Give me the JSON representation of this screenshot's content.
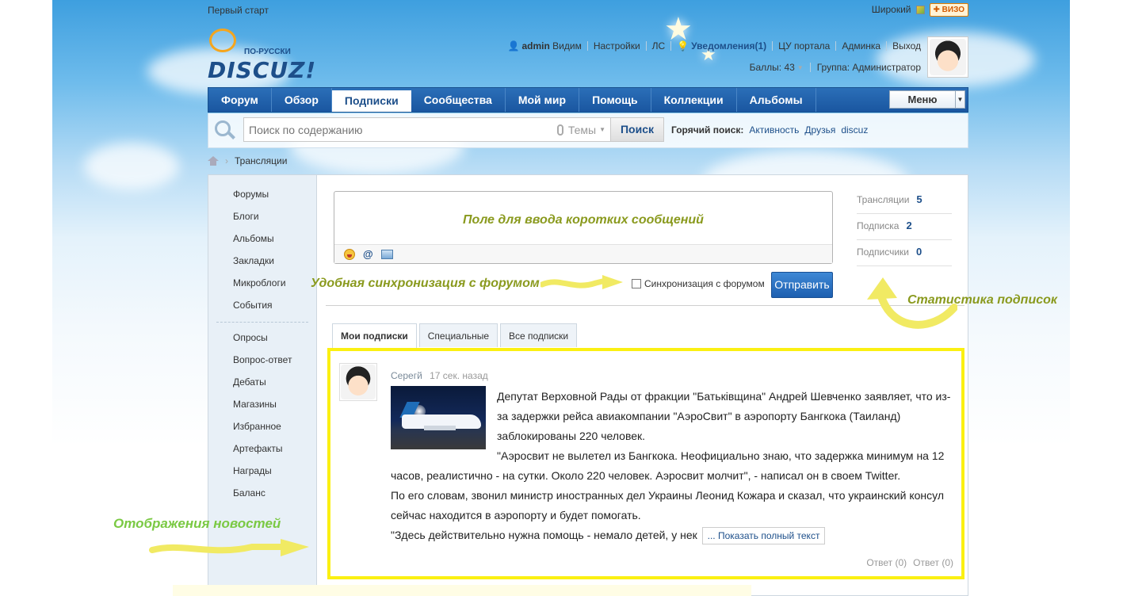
{
  "topbar": {
    "first_start": "Первый старт",
    "wide": "Широкий",
    "vizo": "ВИЗО"
  },
  "logo": {
    "sub": "ПО-РУССКИ",
    "name": "DISCUZ!"
  },
  "user": {
    "name": "admin",
    "status": "Видим",
    "links": [
      "Настройки",
      "ЛС"
    ],
    "notifications": "Уведомления(1)",
    "links2": [
      "ЦУ портала",
      "Админка",
      "Выход"
    ],
    "points": "Баллы: 43",
    "group": "Группа: Администратор"
  },
  "nav": {
    "items": [
      "Форум",
      "Обзор",
      "Подписки",
      "Сообщества",
      "Мой мир",
      "Помощь",
      "Коллекции",
      "Альбомы"
    ],
    "active": "Подписки",
    "menu": "Меню"
  },
  "search": {
    "placeholder": "Поиск по содержанию",
    "type": "Темы",
    "button": "Поиск",
    "hot_label": "Горячий поиск:",
    "hot": [
      "Активность",
      "Друзья",
      "discuz"
    ]
  },
  "breadcrumb": {
    "current": "Трансляции"
  },
  "sidebar": {
    "group1": [
      "Форумы",
      "Блоги",
      "Альбомы",
      "Закладки",
      "Микроблоги",
      "События"
    ],
    "group2": [
      "Опросы",
      "Вопрос-ответ",
      "Дебаты",
      "Магазины",
      "Избранное",
      "Артефакты",
      "Награды",
      "Баланс"
    ]
  },
  "composer": {
    "placeholder": "Поле для ввода коротких сообщений",
    "sync_label": "Синхронизация с форумом",
    "send": "Отправить"
  },
  "stats": [
    {
      "label": "Трансляции",
      "value": "5"
    },
    {
      "label": "Подписка",
      "value": "2"
    },
    {
      "label": "Подписчики",
      "value": "0"
    }
  ],
  "tabs": [
    "Мои подписки",
    "Специальные",
    "Все подписки"
  ],
  "post": {
    "author": "Серегй",
    "time": "17 сек. назад",
    "lines": [
      "Депутат Верховной Рады от фракции \"Батьківщина\" Андрей Шевченко заявляет, что из-",
      "за задержки рейса авиакомпании \"АэроСвит\" в аэропорту Бангкока (Таиланд)",
      "заблокированы 220 человек.",
      "\"Аэросвит не вылетел из Бангкока. Неофициально знаю, что задержка минимум на 12",
      "часов, реалистично - на сутки. Около 220 человек. Аэросвит молчит\", - написал он в своем Twitter.",
      "По его словам, звонил министр иностранных дел Украины Леонид Кожара и сказал, что украинский консул",
      "сейчас находится в аэропорту и будет помогать.",
      "\"Здесь действительно нужна помощь - немало детей, у нек"
    ],
    "more": "... Показать полный текст",
    "reply1": "Ответ (0)",
    "reply2": "Ответ (0)"
  },
  "annotations": {
    "sync": "Удобная синхронизация с форумом",
    "stats": "Статистика подписок",
    "news": "Отображения новостей"
  },
  "colors": {
    "nav_blue": "#1a56a0",
    "highlight": "#fbf012",
    "annotation": "#8a9a1e",
    "annotation_green": "#7ac943"
  }
}
